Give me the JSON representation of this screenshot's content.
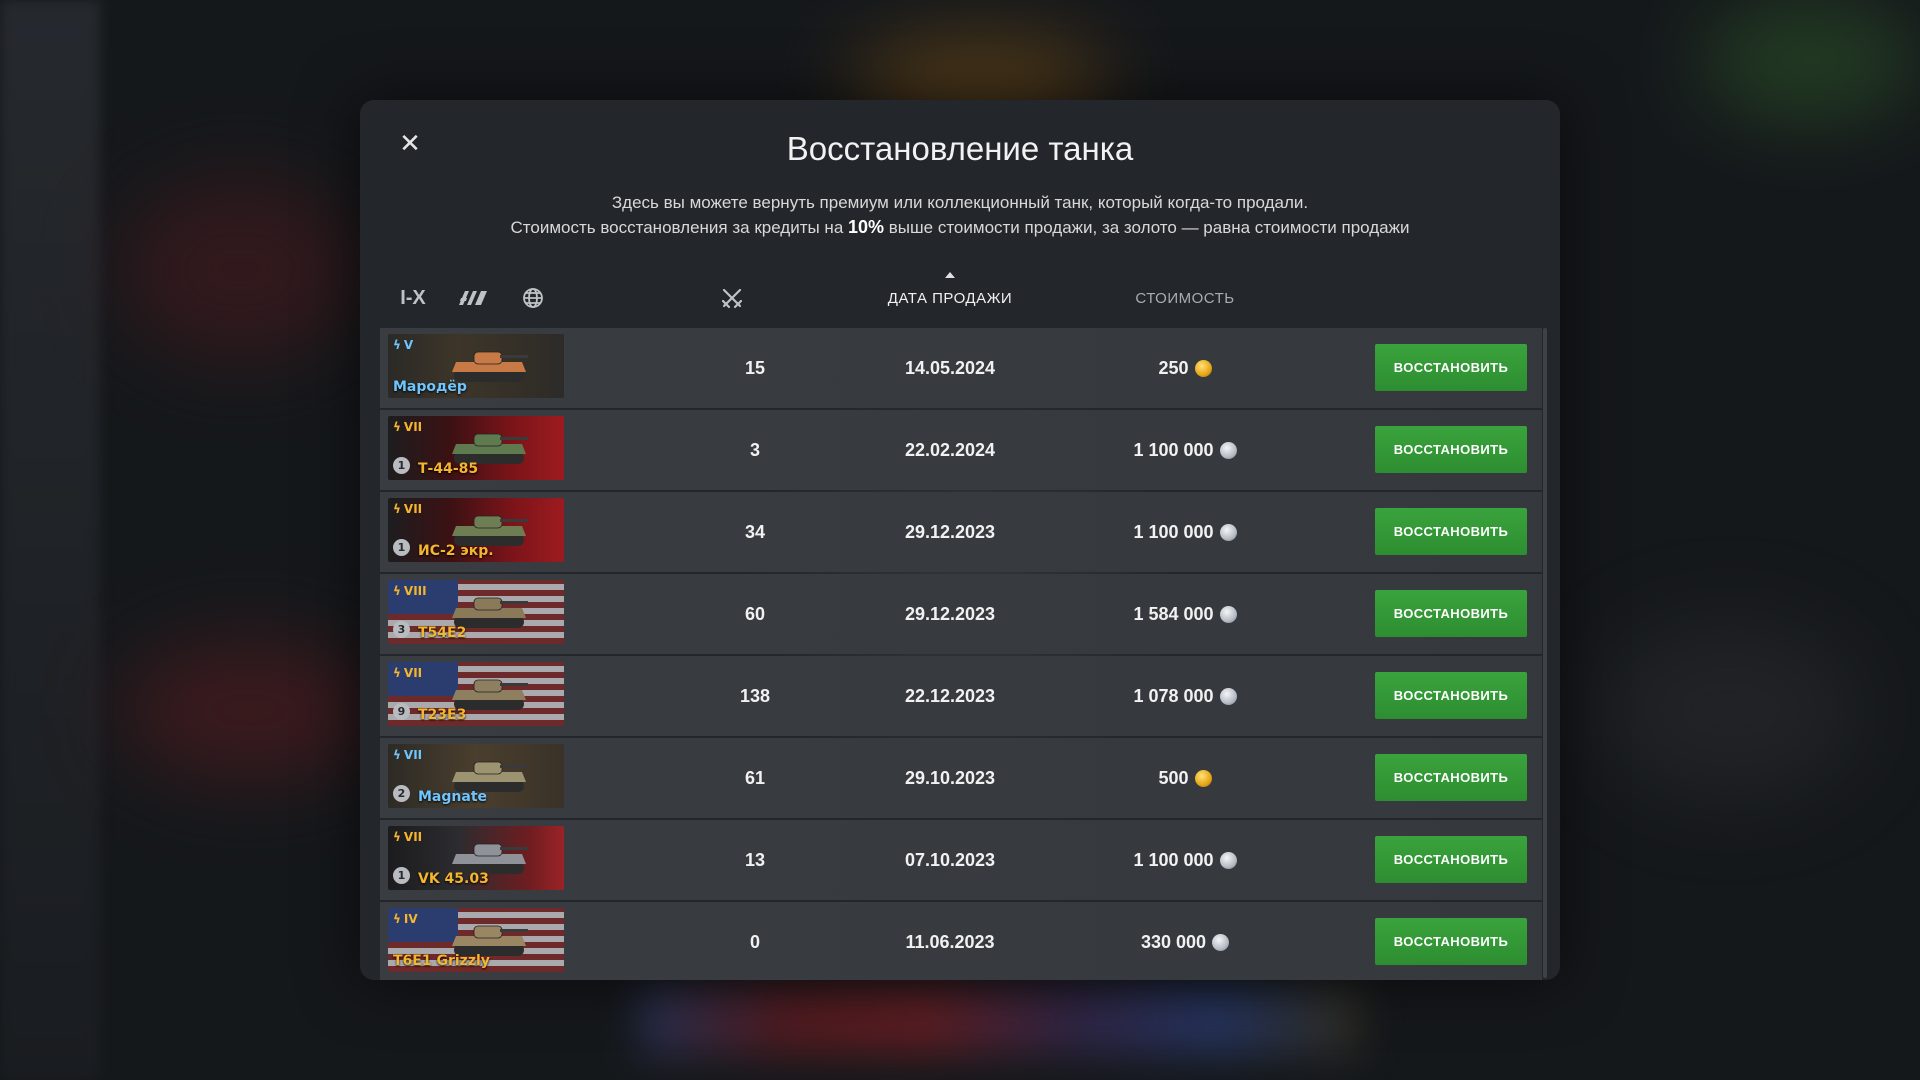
{
  "dialog": {
    "title": "Восстановление танка",
    "subtitle_line1": "Здесь вы можете вернуть премиум или коллекционный танк, который когда-то продали.",
    "subtitle_line2_pre": "Стоимость восстановления за кредиты на ",
    "subtitle_line2_bold": "10%",
    "subtitle_line2_post": " выше стоимости продажи, за золото — равна стоимости продажи",
    "close_icon": "✕"
  },
  "filters": {
    "tier_label": "I-X",
    "type_icon": "vehicle-type-icon",
    "nation_icon": "globe-icon"
  },
  "columns": {
    "battles_icon": "crossed-swords-icon",
    "date_label": "ДАТА ПРОДАЖИ",
    "cost_label": "СТОИМОСТЬ"
  },
  "colors": {
    "accent_green": "#34a039",
    "gold": "#f0b324",
    "premium_name": "#f5b52e",
    "collector_name": "#6ec5ff"
  },
  "restore_label": "ВОССТАНОВИТЬ",
  "tanks": [
    {
      "tier": "V",
      "tier_type": "collector",
      "name": "Мародёр",
      "mastery": "",
      "battles": "15",
      "date": "14.05.2024",
      "price": "250",
      "currency": "gold"
    },
    {
      "tier": "VII",
      "tier_type": "premium",
      "name": "Т-44-85",
      "mastery": "1",
      "battles": "3",
      "date": "22.02.2024",
      "price": "1 100 000",
      "currency": "credits"
    },
    {
      "tier": "VII",
      "tier_type": "premium",
      "name": "ИС-2 экр.",
      "mastery": "1",
      "battles": "34",
      "date": "29.12.2023",
      "price": "1 100 000",
      "currency": "credits"
    },
    {
      "tier": "VIII",
      "tier_type": "premium",
      "name": "T54E2",
      "mastery": "3",
      "battles": "60",
      "date": "29.12.2023",
      "price": "1 584 000",
      "currency": "credits"
    },
    {
      "tier": "VII",
      "tier_type": "premium",
      "name": "T23E3",
      "mastery": "9",
      "battles": "138",
      "date": "22.12.2023",
      "price": "1 078 000",
      "currency": "credits"
    },
    {
      "tier": "VII",
      "tier_type": "collector",
      "name": "Magnate",
      "mastery": "2",
      "battles": "61",
      "date": "29.10.2023",
      "price": "500",
      "currency": "gold"
    },
    {
      "tier": "VII",
      "tier_type": "premium",
      "name": "VK 45.03",
      "mastery": "1",
      "battles": "13",
      "date": "07.10.2023",
      "price": "1 100 000",
      "currency": "credits"
    },
    {
      "tier": "IV",
      "tier_type": "premium",
      "name": "T6E1 Grizzly",
      "mastery": "",
      "battles": "0",
      "date": "11.06.2023",
      "price": "330 000",
      "currency": "credits"
    }
  ]
}
